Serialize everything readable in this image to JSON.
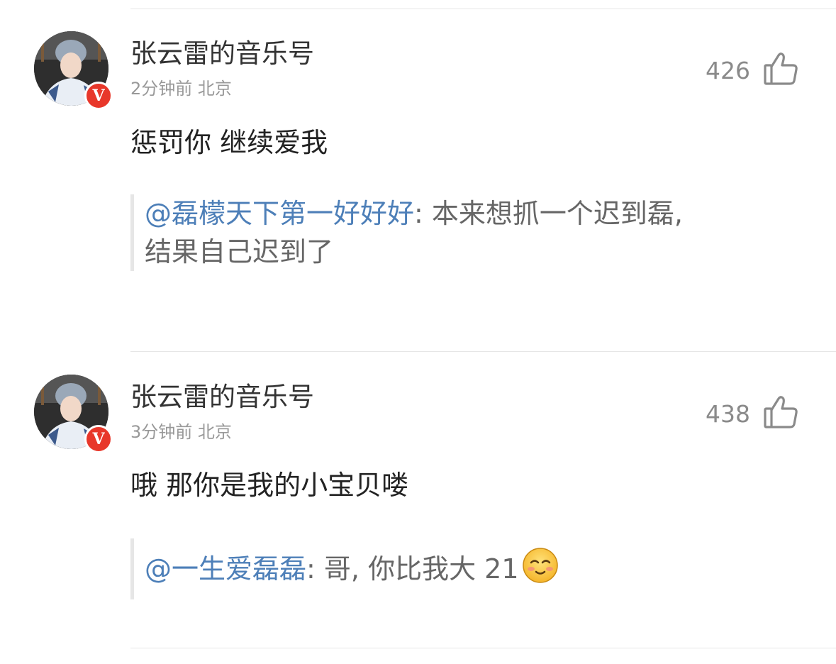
{
  "comments": [
    {
      "author": "张云雷的音乐号",
      "time": "2分钟前",
      "location": "北京",
      "likes": "426",
      "text": "惩罚你 继续爱我",
      "quote": {
        "mention": "@磊檬天下第一好好好",
        "separator": ": ",
        "body_line1": "本来想抓一个迟到磊,",
        "body_line2": "结果自己迟到了"
      },
      "badge": "V"
    },
    {
      "author": "张云雷的音乐号",
      "time": "3分钟前",
      "location": "北京",
      "likes": "438",
      "text": "哦 那你是我的小宝贝喽",
      "quote": {
        "mention": "@一生爱磊磊",
        "separator": ": ",
        "body_line1": "哥, 你比我大 21",
        "emoji": "blush-emoji"
      },
      "badge": "V"
    }
  ],
  "colors": {
    "mention": "#4d7fb8",
    "badge": "#e8372a",
    "divider": "#e6e6e6"
  },
  "icons": [
    "thumbs-up-icon",
    "verified-v-badge",
    "blush-emoji"
  ]
}
